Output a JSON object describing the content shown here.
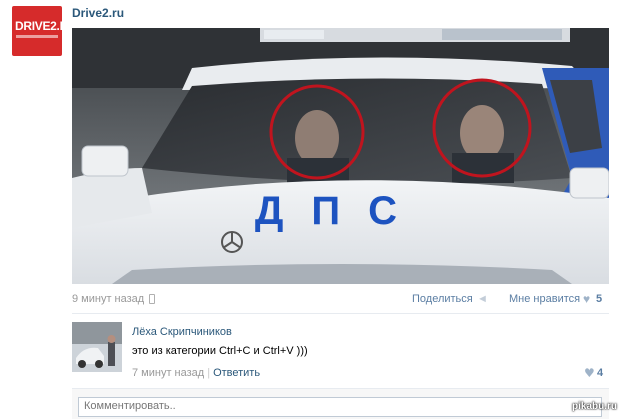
{
  "post": {
    "author": "Drive2.ru",
    "avatar_logo": "DRIVE2.RU",
    "time": "9 минут назад",
    "share_label": "Поделиться",
    "like_label": "Мне нравится",
    "like_count": "5",
    "photo_plate_text": "ДПС"
  },
  "comment": {
    "author": "Лёха Скрипчиников",
    "text": "это из категории Ctrl+C и Ctrl+V )))",
    "time": "7 минут назад",
    "separator": "|",
    "reply_label": "Ответить",
    "like_count": "4"
  },
  "composer": {
    "placeholder": "Комментировать.."
  },
  "watermark": "pikabu.ru",
  "icons": {
    "phone": "phone-icon",
    "share": "megaphone-icon",
    "like": "heart-icon"
  },
  "colors": {
    "link": "#2b587a",
    "brand": "#d62b2b",
    "highlight_circle": "#c0141e"
  }
}
